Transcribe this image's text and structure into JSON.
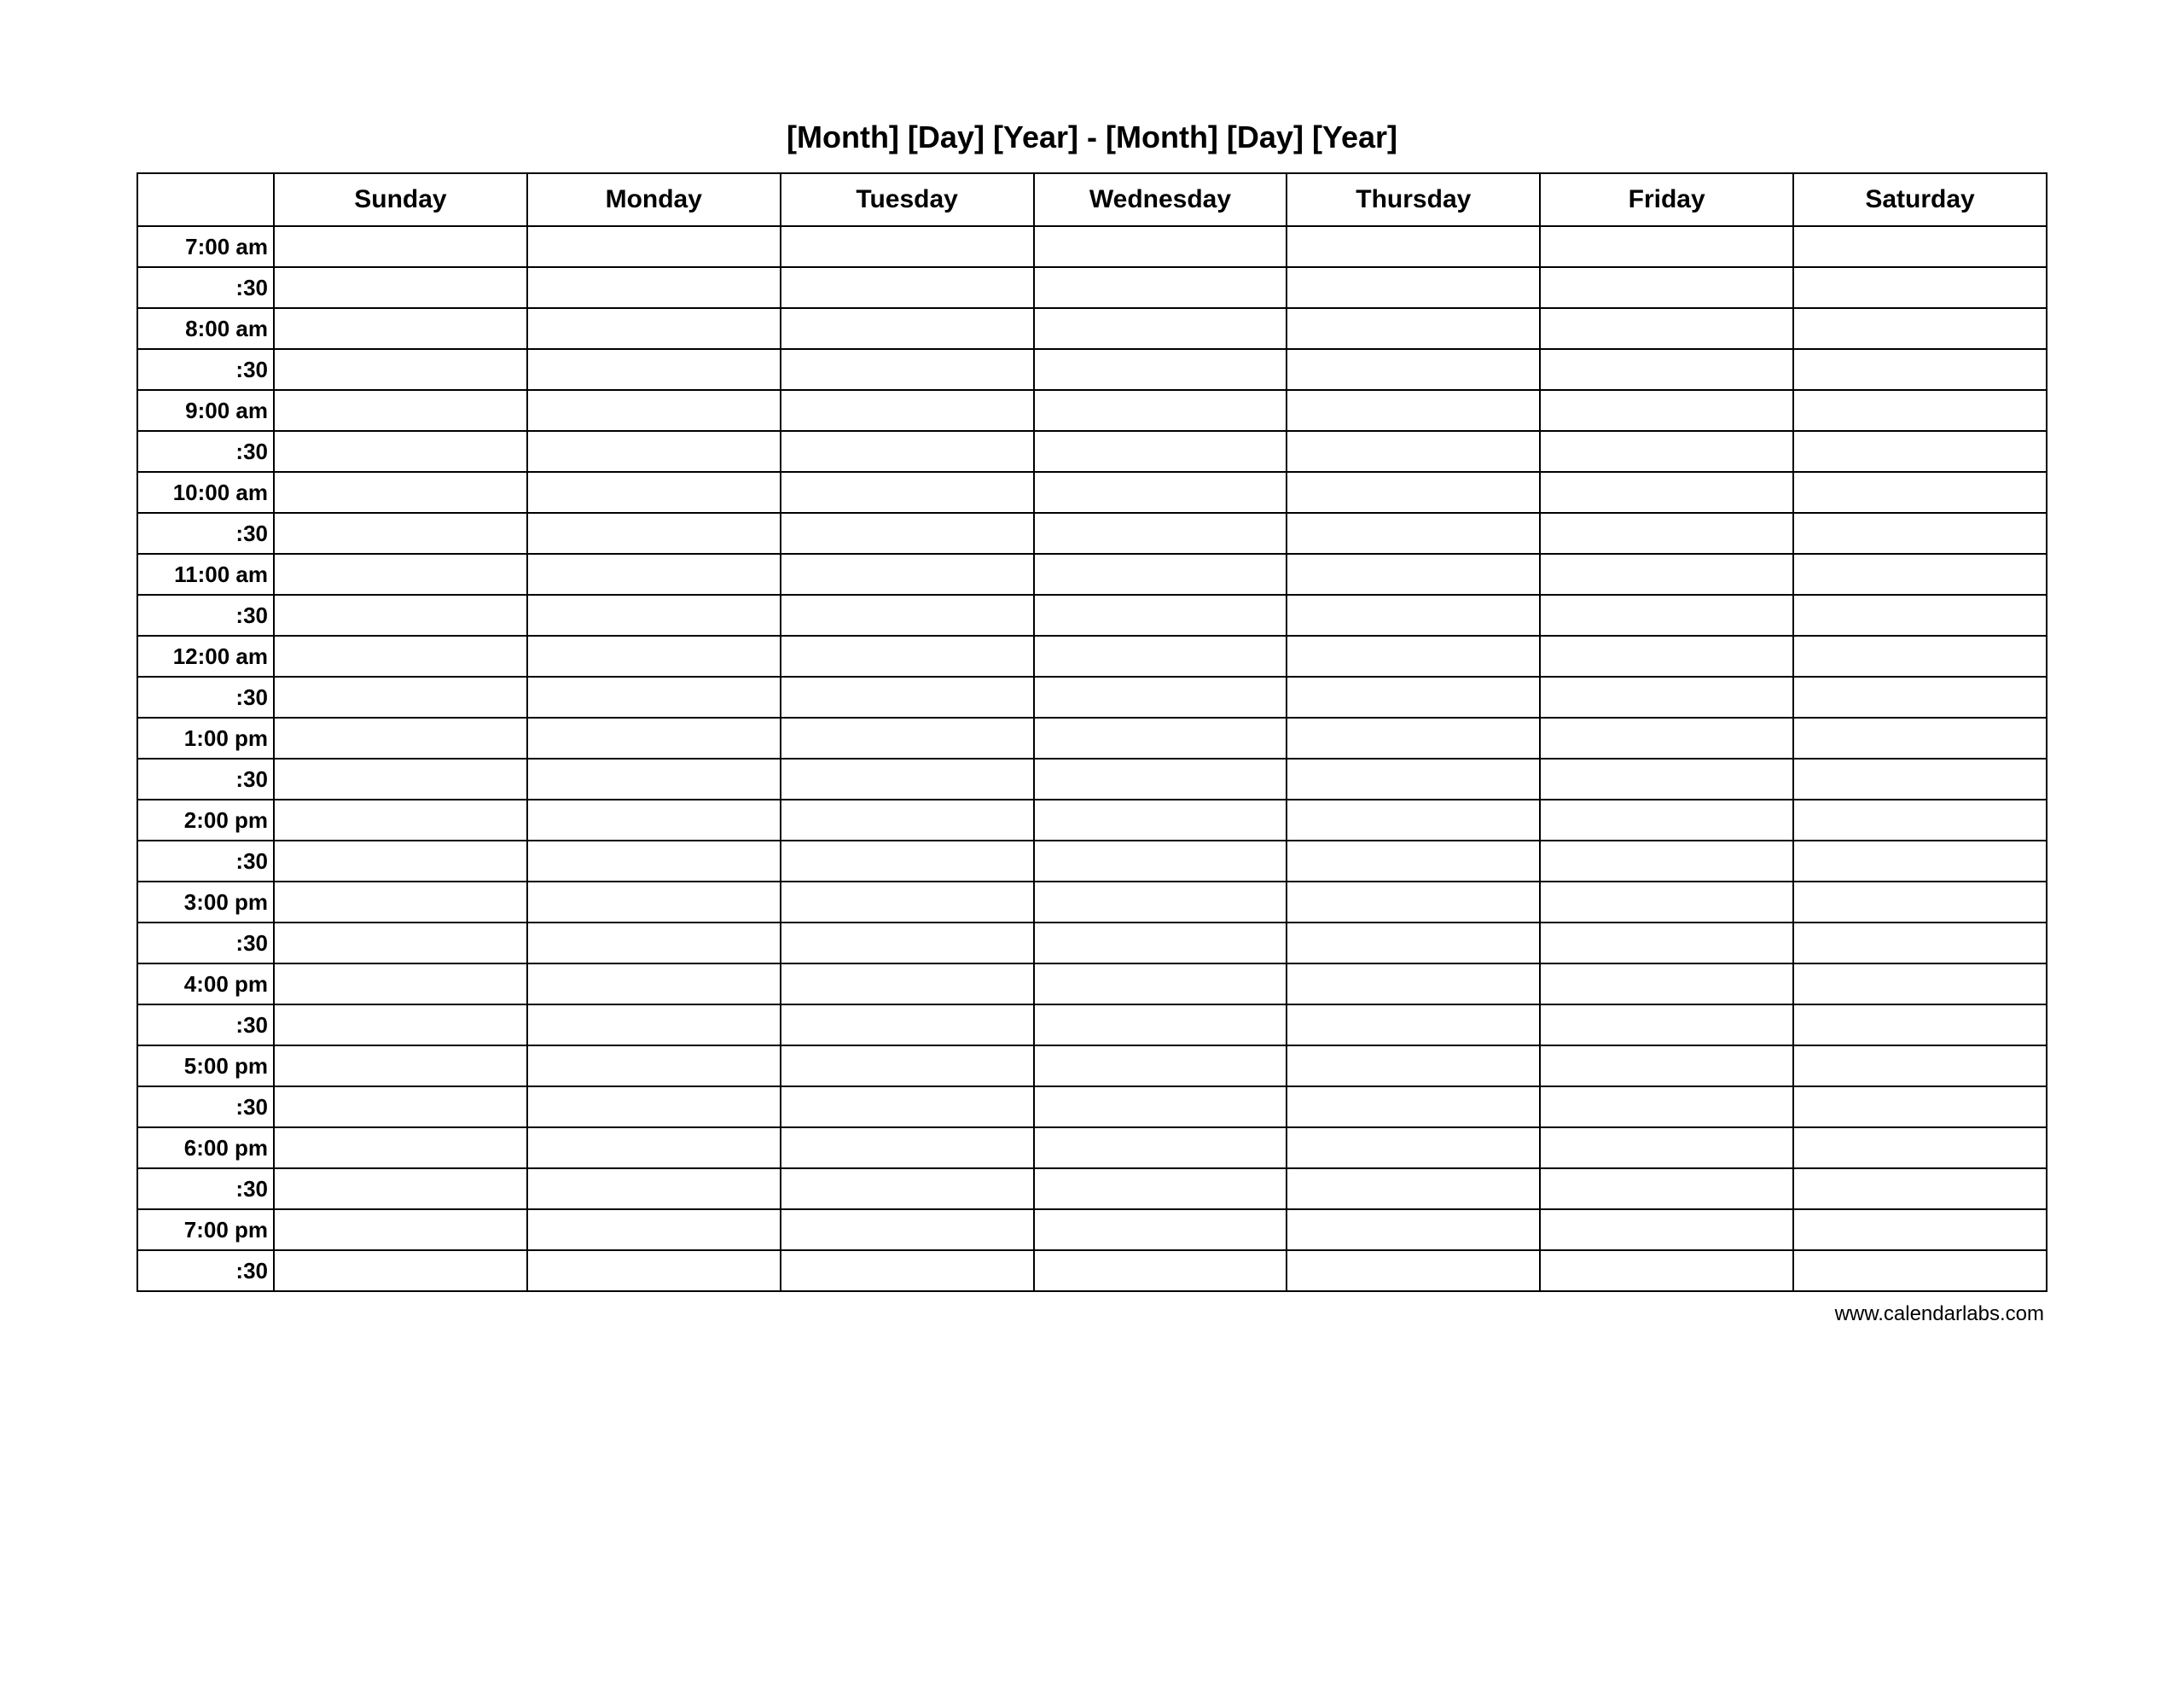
{
  "title": "[Month] [Day] [Year] - [Month] [Day] [Year]",
  "days": [
    "Sunday",
    "Monday",
    "Tuesday",
    "Wednesday",
    "Thursday",
    "Friday",
    "Saturday"
  ],
  "times": [
    "7:00 am",
    ":30",
    "8:00 am",
    ":30",
    "9:00 am",
    ":30",
    "10:00 am",
    ":30",
    "11:00 am",
    ":30",
    "12:00 am",
    ":30",
    "1:00 pm",
    ":30",
    "2:00 pm",
    ":30",
    "3:00 pm",
    ":30",
    "4:00 pm",
    ":30",
    "5:00 pm",
    ":30",
    "6:00 pm",
    ":30",
    "7:00 pm",
    ":30"
  ],
  "footer": "www.calendarlabs.com"
}
